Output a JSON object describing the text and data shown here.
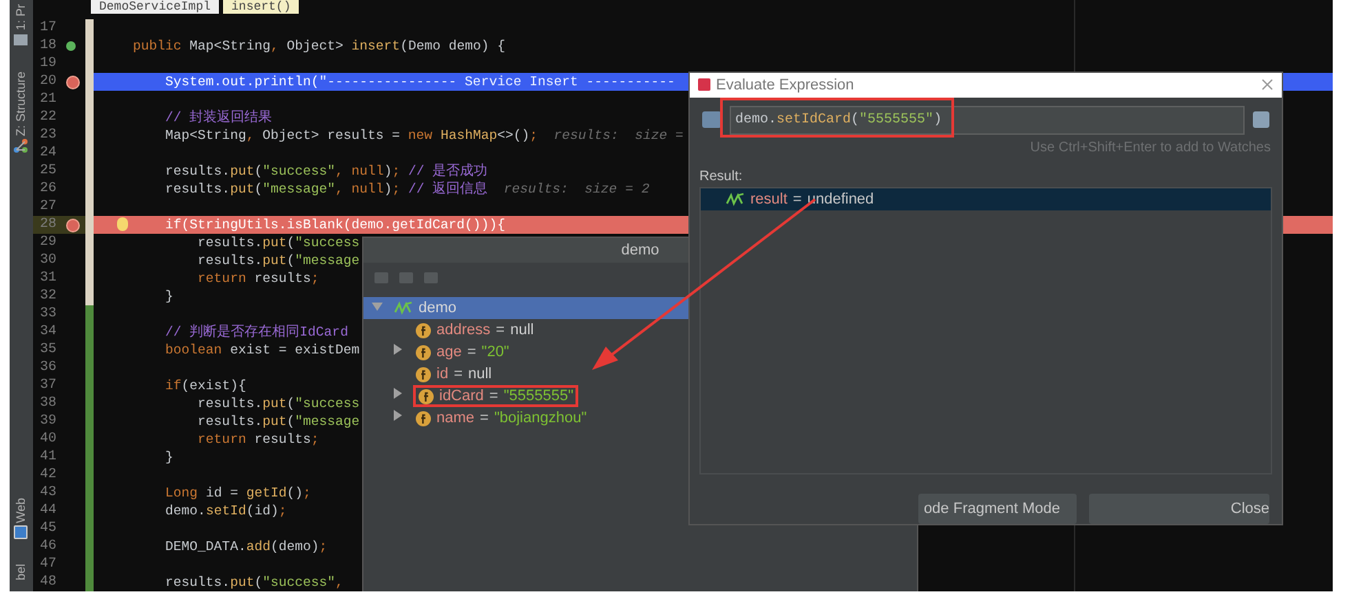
{
  "editor_tabs": [
    {
      "label": "DemoServiceImpl",
      "selected": false
    },
    {
      "label": "insert()",
      "selected": true
    }
  ],
  "tool_stripe": [
    {
      "label": "1: Pr",
      "kind": "project"
    },
    {
      "label": "Z: Structure",
      "kind": "structure"
    },
    {
      "label": "Web",
      "kind": "web"
    },
    {
      "label": "bel",
      "kind": "plain"
    }
  ],
  "code_lines": [
    {
      "number": "17",
      "current": false,
      "breakpoint": false,
      "override_marker": false
    },
    {
      "number": "18",
      "current": false,
      "breakpoint": false,
      "override_marker": true,
      "segments": [
        {
          "kind": "keyword",
          "text": "    public "
        },
        {
          "kind": "plain",
          "text": "Map<String"
        },
        {
          "kind": "keyword",
          "text": ", "
        },
        {
          "kind": "plain",
          "text": "Object> "
        },
        {
          "kind": "method",
          "text": "insert"
        },
        {
          "kind": "plain",
          "text": "(Demo demo) {"
        }
      ]
    },
    {
      "number": "19",
      "current": false,
      "breakpoint": false,
      "override_marker": false
    },
    {
      "number": "20",
      "current": true,
      "breakpoint": true,
      "override_marker": false,
      "segments": [
        {
          "kind": "plain",
          "text": "        System.out.println("
        },
        {
          "kind": "string",
          "text": "\"---------------- Service Insert -----------"
        }
      ]
    },
    {
      "number": "21",
      "current": false,
      "breakpoint": false,
      "override_marker": false
    },
    {
      "number": "22",
      "current": false,
      "breakpoint": false,
      "override_marker": false,
      "segments": [
        {
          "kind": "comment",
          "text": "        // 封装返回结果"
        }
      ]
    },
    {
      "number": "23",
      "current": false,
      "breakpoint": false,
      "override_marker": false,
      "segments": [
        {
          "kind": "plain",
          "text": "        Map<String"
        },
        {
          "kind": "keyword",
          "text": ", "
        },
        {
          "kind": "plain",
          "text": "Object> results = "
        },
        {
          "kind": "keyword",
          "text": "new "
        },
        {
          "kind": "method",
          "text": "HashMap"
        },
        {
          "kind": "plain",
          "text": "<>()"
        },
        {
          "kind": "keyword",
          "text": ";"
        },
        {
          "kind": "hint",
          "text": "  results:  size ="
        }
      ]
    },
    {
      "number": "24",
      "current": false,
      "breakpoint": false,
      "override_marker": false
    },
    {
      "number": "25",
      "current": false,
      "breakpoint": false,
      "override_marker": false,
      "segments": [
        {
          "kind": "plain",
          "text": "        results."
        },
        {
          "kind": "method",
          "text": "put"
        },
        {
          "kind": "plain",
          "text": "("
        },
        {
          "kind": "string",
          "text": "\"success\""
        },
        {
          "kind": "keyword",
          "text": ", null"
        },
        {
          "kind": "plain",
          "text": ")"
        },
        {
          "kind": "keyword",
          "text": ";"
        },
        {
          "kind": "comment",
          "text": " // 是否成功"
        }
      ]
    },
    {
      "number": "26",
      "current": false,
      "breakpoint": false,
      "override_marker": false,
      "segments": [
        {
          "kind": "plain",
          "text": "        results."
        },
        {
          "kind": "method",
          "text": "put"
        },
        {
          "kind": "plain",
          "text": "("
        },
        {
          "kind": "string",
          "text": "\"message\""
        },
        {
          "kind": "keyword",
          "text": ", null"
        },
        {
          "kind": "plain",
          "text": ")"
        },
        {
          "kind": "keyword",
          "text": ";"
        },
        {
          "kind": "comment",
          "text": " // 返回信息"
        },
        {
          "kind": "hint",
          "text": "  results:  size = 2"
        }
      ]
    },
    {
      "number": "27",
      "current": false,
      "breakpoint": false,
      "override_marker": false
    },
    {
      "number": "28",
      "current": false,
      "breakpoint": true,
      "override_marker": false,
      "segments": [
        {
          "kind": "plain",
          "text": "        if(StringUtils.isBlank(demo.getIdCard())){"
        }
      ]
    },
    {
      "number": "29",
      "current": false,
      "breakpoint": false,
      "override_marker": false,
      "segments": [
        {
          "kind": "plain",
          "text": "            results."
        },
        {
          "kind": "method",
          "text": "put"
        },
        {
          "kind": "plain",
          "text": "("
        },
        {
          "kind": "string",
          "text": "\"success"
        }
      ]
    },
    {
      "number": "30",
      "current": false,
      "breakpoint": false,
      "override_marker": false,
      "segments": [
        {
          "kind": "plain",
          "text": "            results."
        },
        {
          "kind": "method",
          "text": "put"
        },
        {
          "kind": "plain",
          "text": "("
        },
        {
          "kind": "string",
          "text": "\"message"
        }
      ]
    },
    {
      "number": "31",
      "current": false,
      "breakpoint": false,
      "override_marker": false,
      "segments": [
        {
          "kind": "keyword",
          "text": "            return "
        },
        {
          "kind": "plain",
          "text": "results"
        },
        {
          "kind": "keyword",
          "text": ";"
        }
      ]
    },
    {
      "number": "32",
      "current": false,
      "breakpoint": false,
      "override_marker": false,
      "segments": [
        {
          "kind": "plain",
          "text": "        }"
        }
      ]
    },
    {
      "number": "33",
      "current": false,
      "breakpoint": false,
      "override_marker": false
    },
    {
      "number": "34",
      "current": false,
      "breakpoint": false,
      "override_marker": false,
      "segments": [
        {
          "kind": "comment",
          "text": "        // 判断是否存在相同IdCard"
        }
      ]
    },
    {
      "number": "35",
      "current": false,
      "breakpoint": false,
      "override_marker": false,
      "segments": [
        {
          "kind": "keyword",
          "text": "        boolean "
        },
        {
          "kind": "plain",
          "text": "exist = existDem"
        }
      ]
    },
    {
      "number": "36",
      "current": false,
      "breakpoint": false,
      "override_marker": false
    },
    {
      "number": "37",
      "current": false,
      "breakpoint": false,
      "override_marker": false,
      "segments": [
        {
          "kind": "keyword",
          "text": "        if"
        },
        {
          "kind": "plain",
          "text": "(exist){"
        }
      ]
    },
    {
      "number": "38",
      "current": false,
      "breakpoint": false,
      "override_marker": false,
      "segments": [
        {
          "kind": "plain",
          "text": "            results."
        },
        {
          "kind": "method",
          "text": "put"
        },
        {
          "kind": "plain",
          "text": "("
        },
        {
          "kind": "string",
          "text": "\"success"
        }
      ]
    },
    {
      "number": "39",
      "current": false,
      "breakpoint": false,
      "override_marker": false,
      "segments": [
        {
          "kind": "plain",
          "text": "            results."
        },
        {
          "kind": "method",
          "text": "put"
        },
        {
          "kind": "plain",
          "text": "("
        },
        {
          "kind": "string",
          "text": "\"message"
        }
      ]
    },
    {
      "number": "40",
      "current": false,
      "breakpoint": false,
      "override_marker": false,
      "segments": [
        {
          "kind": "keyword",
          "text": "            return "
        },
        {
          "kind": "plain",
          "text": "results"
        },
        {
          "kind": "keyword",
          "text": ";"
        }
      ]
    },
    {
      "number": "41",
      "current": false,
      "breakpoint": false,
      "override_marker": false,
      "segments": [
        {
          "kind": "plain",
          "text": "        }"
        }
      ]
    },
    {
      "number": "42",
      "current": false,
      "breakpoint": false,
      "override_marker": false
    },
    {
      "number": "43",
      "current": false,
      "breakpoint": false,
      "override_marker": false,
      "segments": [
        {
          "kind": "keyword",
          "text": "        Long "
        },
        {
          "kind": "plain",
          "text": "id = "
        },
        {
          "kind": "method",
          "text": "getId"
        },
        {
          "kind": "plain",
          "text": "()"
        },
        {
          "kind": "keyword",
          "text": ";"
        }
      ]
    },
    {
      "number": "44",
      "current": false,
      "breakpoint": false,
      "override_marker": false,
      "segments": [
        {
          "kind": "plain",
          "text": "        demo."
        },
        {
          "kind": "method",
          "text": "setId"
        },
        {
          "kind": "plain",
          "text": "(id)"
        },
        {
          "kind": "keyword",
          "text": ";"
        }
      ]
    },
    {
      "number": "45",
      "current": false,
      "breakpoint": false,
      "override_marker": false
    },
    {
      "number": "46",
      "current": false,
      "breakpoint": false,
      "override_marker": false,
      "segments": [
        {
          "kind": "plain",
          "text": "        DEMO_DATA."
        },
        {
          "kind": "method",
          "text": "add"
        },
        {
          "kind": "plain",
          "text": "(demo)"
        },
        {
          "kind": "keyword",
          "text": ";"
        }
      ]
    },
    {
      "number": "47",
      "current": false,
      "breakpoint": false,
      "override_marker": false
    },
    {
      "number": "48",
      "current": false,
      "breakpoint": false,
      "override_marker": false,
      "segments": [
        {
          "kind": "plain",
          "text": "        results."
        },
        {
          "kind": "method",
          "text": "put"
        },
        {
          "kind": "plain",
          "text": "("
        },
        {
          "kind": "string",
          "text": "\"success\""
        },
        {
          "kind": "keyword",
          "text": ","
        }
      ]
    }
  ],
  "variables_popup": {
    "title": "demo",
    "tree": [
      {
        "name": "demo",
        "expanded": true,
        "selected": true,
        "kind": "watch",
        "children": [
          {
            "name": "address",
            "separator": "=",
            "value": {
              "kind": "null",
              "text": "null"
            },
            "expandable": false,
            "annotated": false,
            "kind": "field"
          },
          {
            "name": "age",
            "separator": "=",
            "value": {
              "kind": "string",
              "text": "\"20\""
            },
            "expandable": true,
            "annotated": false,
            "kind": "field"
          },
          {
            "name": "id",
            "separator": "=",
            "value": {
              "kind": "null",
              "text": "null"
            },
            "expandable": false,
            "annotated": false,
            "kind": "field"
          },
          {
            "name": "idCard",
            "separator": "=",
            "value": {
              "kind": "string",
              "text": "\"5555555\""
            },
            "expandable": true,
            "annotated": true,
            "kind": "field"
          },
          {
            "name": "name",
            "separator": "=",
            "value": {
              "kind": "string",
              "text": "\"bojiangzhou\""
            },
            "expandable": true,
            "annotated": false,
            "kind": "field"
          }
        ]
      }
    ]
  },
  "evaluate_dialog": {
    "title": "Evaluate Expression",
    "expression": {
      "annotated": true,
      "segments": [
        {
          "kind": "plain",
          "text": "demo."
        },
        {
          "kind": "method",
          "text": "setIdCard"
        },
        {
          "kind": "plain",
          "text": "("
        },
        {
          "kind": "string",
          "text": "\"5555555\""
        },
        {
          "kind": "plain",
          "text": ")"
        }
      ]
    },
    "hint": "Use Ctrl+Shift+Enter to add to Watches",
    "result_label": "Result:",
    "result": [
      {
        "name": "result",
        "separator": "=",
        "value": "undefined",
        "selected": true
      }
    ],
    "buttons": [
      {
        "label": "ode Fragment Mode"
      },
      {
        "label": "Close"
      }
    ]
  }
}
